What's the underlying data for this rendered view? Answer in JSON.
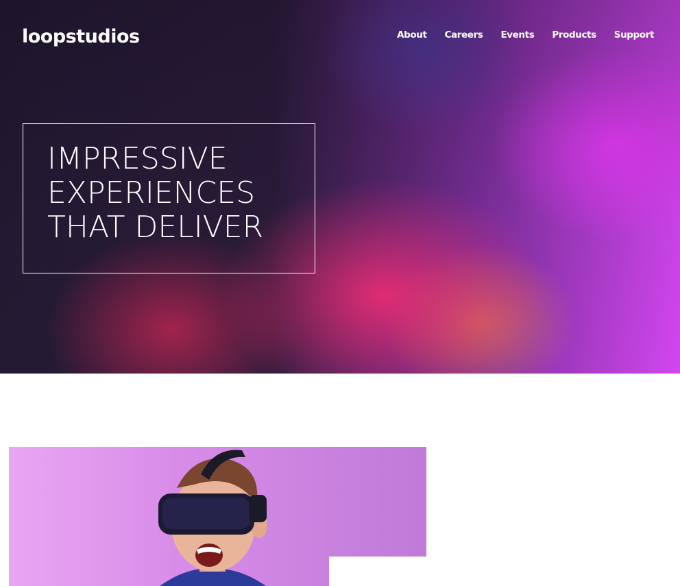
{
  "header": {
    "logo": "loopstudios",
    "nav": [
      "About",
      "Careers",
      "Events",
      "Products",
      "Support"
    ]
  },
  "hero": {
    "headline_lines": [
      "IMPRESSIVE",
      "EXPERIENCES",
      "THAT DELIVER"
    ]
  },
  "colors": {
    "text_light": "#ffffff",
    "accent_magenta": "#d246f0",
    "feature_bg": "#d88ce8"
  }
}
